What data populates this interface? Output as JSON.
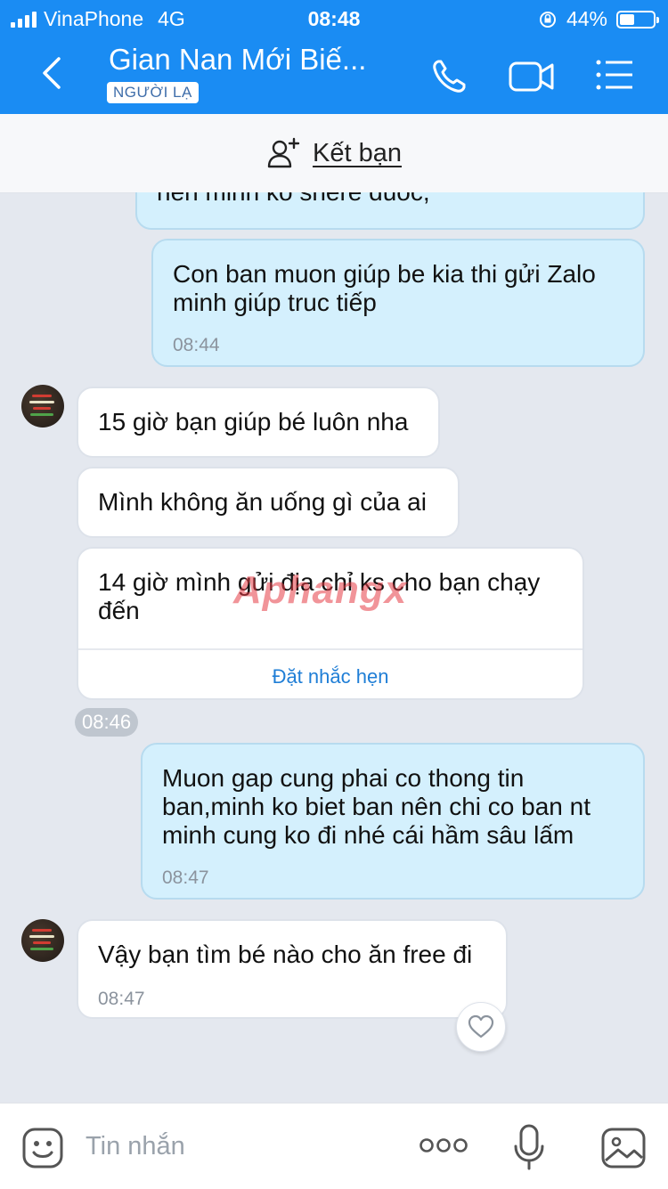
{
  "status_bar": {
    "carrier": "VinaPhone",
    "network": "4G",
    "time": "08:48",
    "battery": "44%",
    "battery_level": 0.44
  },
  "header": {
    "title": "Gian Nan Mới Biế...",
    "tag": "NGƯỜI LẠ",
    "icons": [
      "back-icon",
      "phone-icon",
      "video-call-icon",
      "menu-list-icon"
    ]
  },
  "friend_bar": {
    "label": "Kết bạn"
  },
  "messages": [
    {
      "side": "mine",
      "text": "hen minh ko shere duoc,",
      "time": ""
    },
    {
      "side": "mine",
      "text": "Con ban muon giúp be kia thi gửi Zalo minh giúp truc tiếp",
      "time": "08:44"
    },
    {
      "side": "theirs",
      "text": "15 giờ bạn giúp bé luôn nha",
      "time": ""
    },
    {
      "side": "theirs",
      "text": "Mình không ăn uống gì của ai",
      "time": ""
    },
    {
      "side": "theirs",
      "text": "14 giờ mình gửi địa chỉ ks cho bạn chạy đến",
      "time": "",
      "action": "Đặt nhắc hẹn"
    },
    {
      "side": "mine",
      "text": "Muon gap cung phai co thong tin ban,minh ko biet ban nên chi co ban nt minh cung ko đi nhé cái hầm sâu lấm",
      "time": "08:47"
    },
    {
      "side": "theirs",
      "text": "Vậy bạn tìm bé nào cho ăn free đi",
      "time": "08:47"
    }
  ],
  "time_pill": "08:46",
  "watermark": "Aphangx",
  "input_bar": {
    "placeholder": "Tin nhắn",
    "icons": [
      "emoji-icon",
      "more-icon",
      "microphone-icon",
      "image-icon"
    ]
  },
  "colors": {
    "header": "#1a8cf3",
    "mine_bubble": "#d4f0fd",
    "theirs_bubble": "#ffffff",
    "chat_background": "#e4e8ef",
    "link": "#1f7ed6"
  }
}
